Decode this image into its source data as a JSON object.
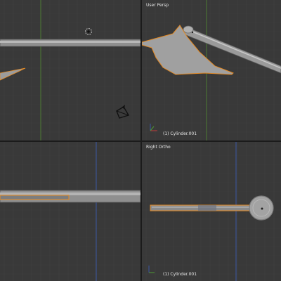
{
  "viewports": {
    "top_left": {
      "object_label": ""
    },
    "top_right": {
      "view_name": "User Persp",
      "object_label": "(1) Cylinder.001"
    },
    "bottom_left": {
      "object_label": ""
    },
    "bottom_right": {
      "view_name": "Right Ortho",
      "object_label": "(1) Cylinder.001"
    }
  },
  "colors": {
    "background": "#393939",
    "grid": "#414141",
    "axis_green": "#4d7a33",
    "axis_red": "#8a3a3a",
    "axis_blue": "#3b57a3",
    "mesh": "#a7a7a7",
    "selection": "#e58a23",
    "divider": "#1b1b1b"
  }
}
